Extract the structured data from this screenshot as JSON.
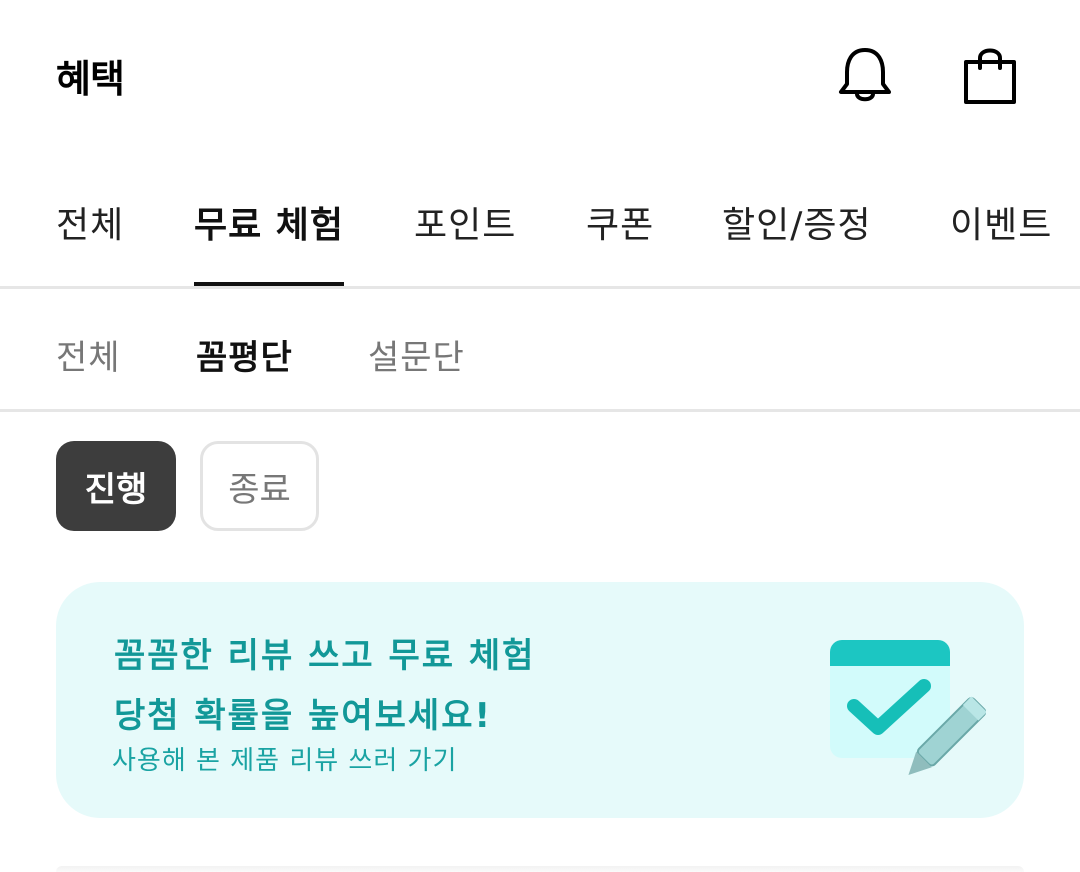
{
  "header": {
    "title": "혜택",
    "icons": [
      "bell-icon",
      "shopping-bag-icon"
    ]
  },
  "main_tabs": [
    {
      "label": "전체",
      "active": false
    },
    {
      "label": "무료 체험",
      "active": true
    },
    {
      "label": "포인트",
      "active": false
    },
    {
      "label": "쿠폰",
      "active": false
    },
    {
      "label": "할인/증정",
      "active": false
    },
    {
      "label": "이벤트",
      "active": false
    }
  ],
  "sub_tabs": [
    {
      "label": "전체",
      "active": false
    },
    {
      "label": "꼼평단",
      "active": true
    },
    {
      "label": "설문단",
      "active": false
    }
  ],
  "filters": [
    {
      "label": "진행",
      "selected": true
    },
    {
      "label": "종료",
      "selected": false
    }
  ],
  "banner": {
    "line1": "꼼꼼한 리뷰 쓰고 무료 체험",
    "line2": "당첨 확률을 높여보세요!",
    "subtext": "사용해 본 제품 리뷰 쓰러 가기",
    "illustration": "calendar-check-pencil-icon"
  },
  "colors": {
    "accent": "#129898",
    "banner_bg": "#e6fafa",
    "chip_selected_bg": "#3d3d3d"
  }
}
